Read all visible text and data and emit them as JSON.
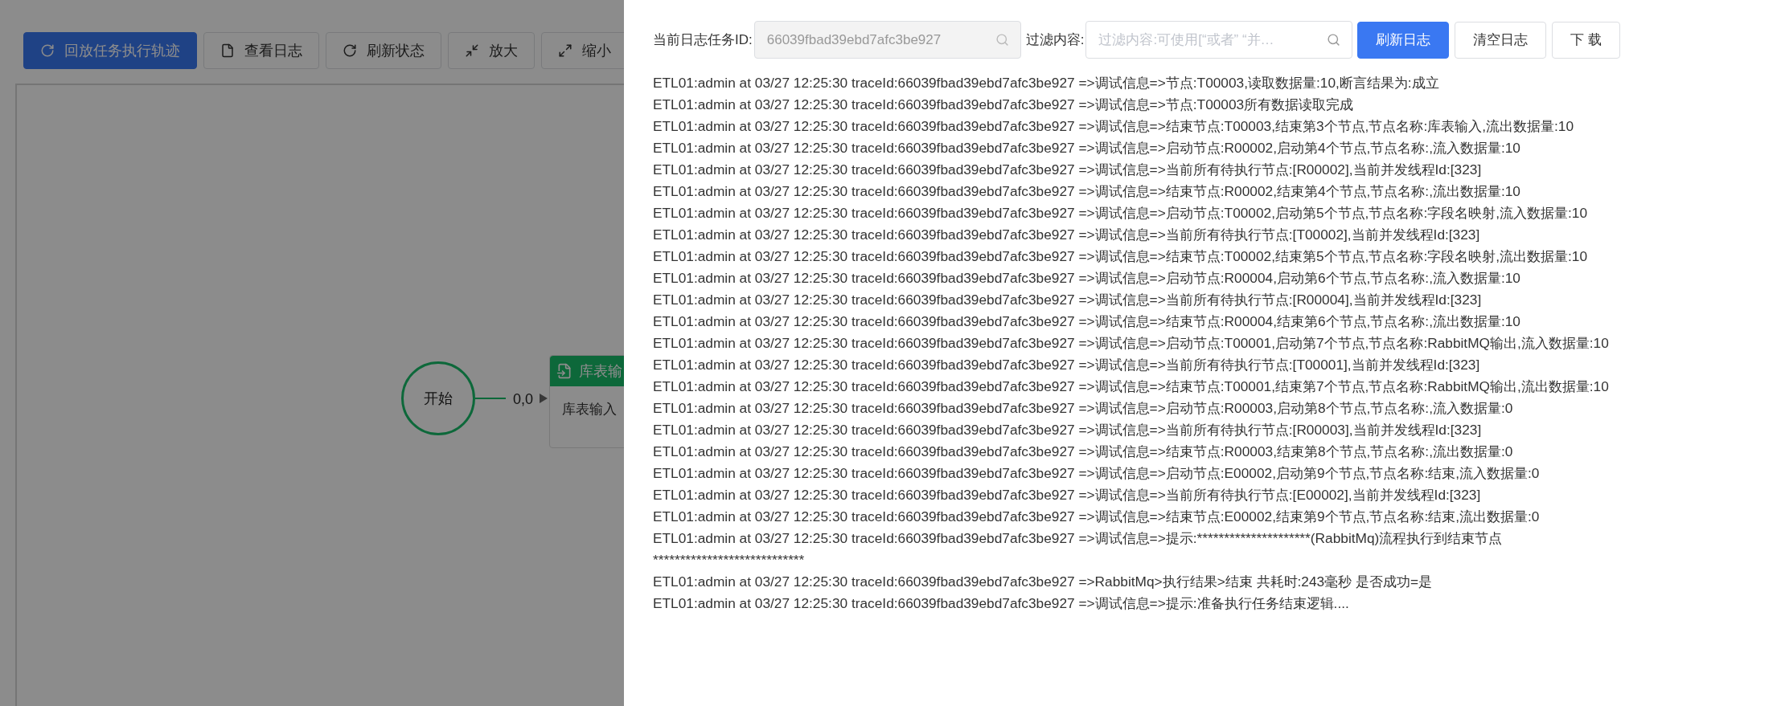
{
  "toolbar": [
    {
      "label": "回放任务执行轨迹",
      "kind": "replay"
    },
    {
      "label": "查看日志",
      "kind": "file"
    },
    {
      "label": "刷新状态",
      "kind": "refresh"
    },
    {
      "label": "放大",
      "kind": "shrink"
    },
    {
      "label": "缩小",
      "kind": "expand"
    }
  ],
  "canvas": {
    "start_node": {
      "label": "开始"
    },
    "edge": {
      "label": "0,0"
    },
    "task_node": {
      "title": "库表输",
      "body": "库表输入"
    }
  },
  "log_drawer": {
    "task_id_label": "当前日志任务ID:",
    "task_id_value": "66039fbad39ebd7afc3be927",
    "filter_label": "过滤内容:",
    "filter_placeholder": "过滤内容:可使用[“或者” “并…",
    "buttons": [
      {
        "label": "刷新日志"
      },
      {
        "label": "清空日志"
      },
      {
        "label": "下 载"
      }
    ],
    "lines": [
      "ETL01:admin at 03/27 12:25:30 traceId:66039fbad39ebd7afc3be927 =>调试信息=>节点:T00003,读取数据量:10,断言结果为:成立",
      "ETL01:admin at 03/27 12:25:30 traceId:66039fbad39ebd7afc3be927 =>调试信息=>节点:T00003所有数据读取完成",
      "ETL01:admin at 03/27 12:25:30 traceId:66039fbad39ebd7afc3be927 =>调试信息=>结束节点:T00003,结束第3个节点,节点名称:库表输入,流出数据量:10",
      "ETL01:admin at 03/27 12:25:30 traceId:66039fbad39ebd7afc3be927 =>调试信息=>启动节点:R00002,启动第4个节点,节点名称:,流入数据量:10",
      "ETL01:admin at 03/27 12:25:30 traceId:66039fbad39ebd7afc3be927 =>调试信息=>当前所有待执行节点:[R00002],当前并发线程Id:[323]",
      "ETL01:admin at 03/27 12:25:30 traceId:66039fbad39ebd7afc3be927 =>调试信息=>结束节点:R00002,结束第4个节点,节点名称:,流出数据量:10",
      "ETL01:admin at 03/27 12:25:30 traceId:66039fbad39ebd7afc3be927 =>调试信息=>启动节点:T00002,启动第5个节点,节点名称:字段名映射,流入数据量:10",
      "ETL01:admin at 03/27 12:25:30 traceId:66039fbad39ebd7afc3be927 =>调试信息=>当前所有待执行节点:[T00002],当前并发线程Id:[323]",
      "ETL01:admin at 03/27 12:25:30 traceId:66039fbad39ebd7afc3be927 =>调试信息=>结束节点:T00002,结束第5个节点,节点名称:字段名映射,流出数据量:10",
      "ETL01:admin at 03/27 12:25:30 traceId:66039fbad39ebd7afc3be927 =>调试信息=>启动节点:R00004,启动第6个节点,节点名称:,流入数据量:10",
      "ETL01:admin at 03/27 12:25:30 traceId:66039fbad39ebd7afc3be927 =>调试信息=>当前所有待执行节点:[R00004],当前并发线程Id:[323]",
      "ETL01:admin at 03/27 12:25:30 traceId:66039fbad39ebd7afc3be927 =>调试信息=>结束节点:R00004,结束第6个节点,节点名称:,流出数据量:10",
      "ETL01:admin at 03/27 12:25:30 traceId:66039fbad39ebd7afc3be927 =>调试信息=>启动节点:T00001,启动第7个节点,节点名称:RabbitMQ输出,流入数据量:10",
      "ETL01:admin at 03/27 12:25:30 traceId:66039fbad39ebd7afc3be927 =>调试信息=>当前所有待执行节点:[T00001],当前并发线程Id:[323]",
      "ETL01:admin at 03/27 12:25:30 traceId:66039fbad39ebd7afc3be927 =>调试信息=>结束节点:T00001,结束第7个节点,节点名称:RabbitMQ输出,流出数据量:10",
      "ETL01:admin at 03/27 12:25:30 traceId:66039fbad39ebd7afc3be927 =>调试信息=>启动节点:R00003,启动第8个节点,节点名称:,流入数据量:0",
      "ETL01:admin at 03/27 12:25:30 traceId:66039fbad39ebd7afc3be927 =>调试信息=>当前所有待执行节点:[R00003],当前并发线程Id:[323]",
      "ETL01:admin at 03/27 12:25:30 traceId:66039fbad39ebd7afc3be927 =>调试信息=>结束节点:R00003,结束第8个节点,节点名称:,流出数据量:0",
      "ETL01:admin at 03/27 12:25:30 traceId:66039fbad39ebd7afc3be927 =>调试信息=>启动节点:E00002,启动第9个节点,节点名称:结束,流入数据量:0",
      "ETL01:admin at 03/27 12:25:30 traceId:66039fbad39ebd7afc3be927 =>调试信息=>当前所有待执行节点:[E00002],当前并发线程Id:[323]",
      "ETL01:admin at 03/27 12:25:30 traceId:66039fbad39ebd7afc3be927 =>调试信息=>结束节点:E00002,结束第9个节点,节点名称:结束,流出数据量:0",
      "ETL01:admin at 03/27 12:25:30 traceId:66039fbad39ebd7afc3be927 =>调试信息=>提示:*********************(RabbitMq)流程执行到结束节点",
      "****************************",
      "ETL01:admin at 03/27 12:25:30 traceId:66039fbad39ebd7afc3be927 =>RabbitMq>执行结果>结束 共耗时:243毫秒 是否成功=是",
      "ETL01:admin at 03/27 12:25:30 traceId:66039fbad39ebd7afc3be927 =>调试信息=>提示:准备执行任务结束逻辑...."
    ]
  }
}
